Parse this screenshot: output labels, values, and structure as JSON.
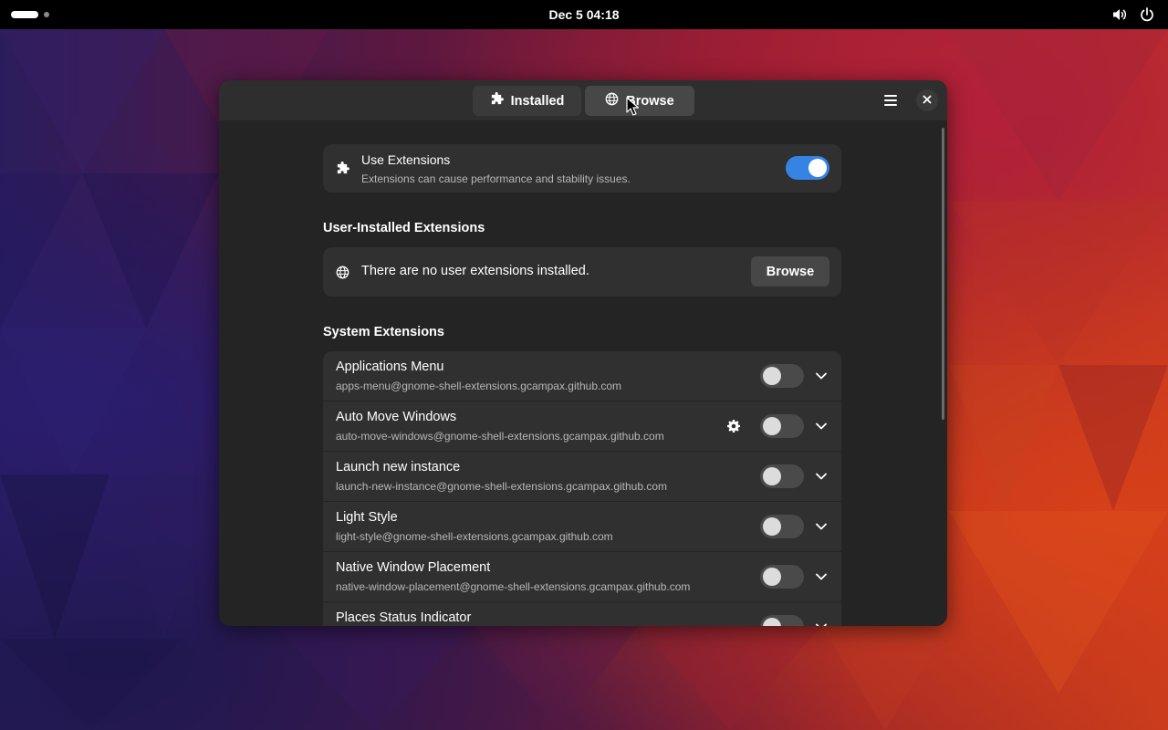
{
  "topbar": {
    "clock": "Dec 5  04:18",
    "icons": [
      "volume-icon",
      "power-icon"
    ]
  },
  "window": {
    "tabs": [
      {
        "label": "Installed",
        "icon": "puzzle-icon"
      },
      {
        "label": "Browse",
        "icon": "globe-icon"
      }
    ],
    "menu_icon": "hamburger-menu-icon",
    "close_icon": "close-icon"
  },
  "use_extensions": {
    "title": "Use Extensions",
    "subtitle": "Extensions can cause performance and stability issues.",
    "enabled": true
  },
  "user_installed": {
    "heading": "User-Installed Extensions",
    "empty_message": "There are no user extensions installed.",
    "browse_label": "Browse"
  },
  "system": {
    "heading": "System Extensions",
    "items": [
      {
        "name": "Applications Menu",
        "uuid": "apps-menu@gnome-shell-extensions.gcampax.github.com",
        "enabled": false,
        "has_settings": false
      },
      {
        "name": "Auto Move Windows",
        "uuid": "auto-move-windows@gnome-shell-extensions.gcampax.github.com",
        "enabled": false,
        "has_settings": true
      },
      {
        "name": "Launch new instance",
        "uuid": "launch-new-instance@gnome-shell-extensions.gcampax.github.com",
        "enabled": false,
        "has_settings": false
      },
      {
        "name": "Light Style",
        "uuid": "light-style@gnome-shell-extensions.gcampax.github.com",
        "enabled": false,
        "has_settings": false
      },
      {
        "name": "Native Window Placement",
        "uuid": "native-window-placement@gnome-shell-extensions.gcampax.github.com",
        "enabled": false,
        "has_settings": false
      },
      {
        "name": "Places Status Indicator",
        "uuid": "",
        "enabled": false,
        "has_settings": false
      }
    ]
  },
  "colors": {
    "accent": "#3584e4",
    "window_bg": "#242424",
    "card_bg": "#303030"
  }
}
